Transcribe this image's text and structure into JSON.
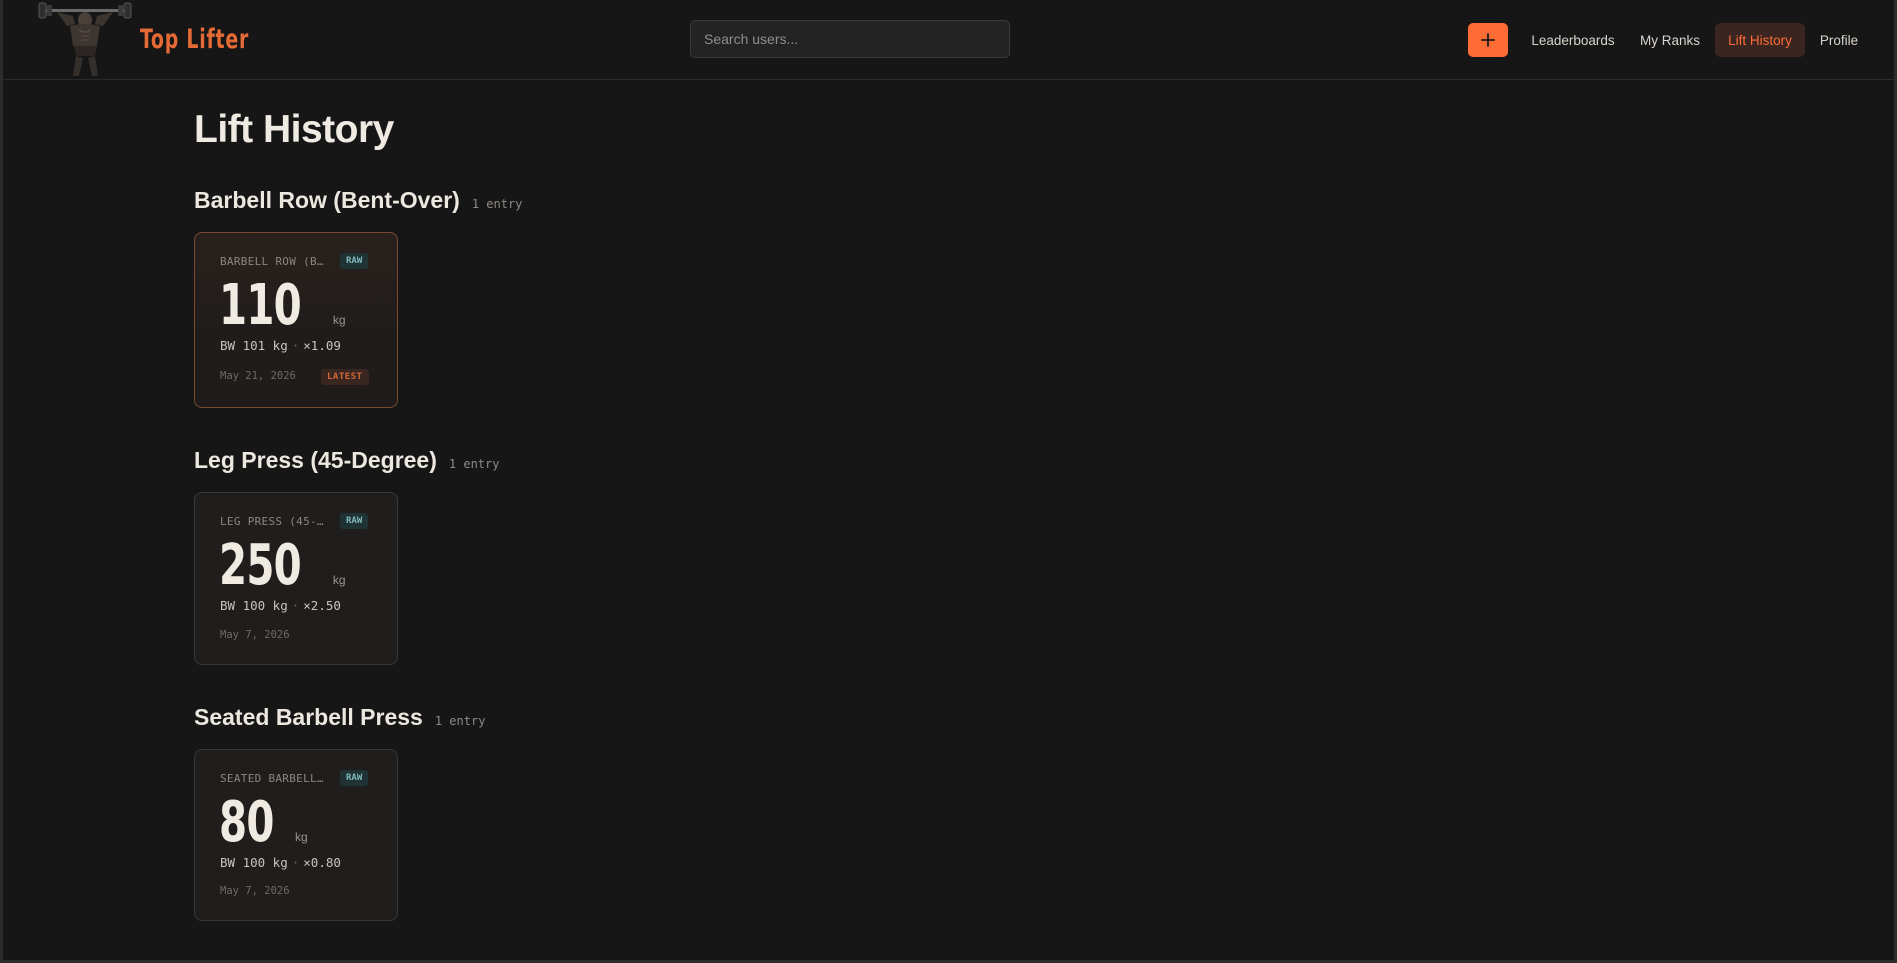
{
  "header": {
    "brand": "Top Lifter",
    "logo_icon": "weightlifter-logo-icon",
    "search": {
      "placeholder": "Search users...",
      "value": ""
    },
    "add_icon": "plus-icon",
    "nav": [
      {
        "label": "Leaderboards",
        "active": false
      },
      {
        "label": "My Ranks",
        "active": false
      },
      {
        "label": "Lift History",
        "active": true
      },
      {
        "label": "Profile",
        "active": false
      }
    ]
  },
  "page": {
    "title": "Lift History"
  },
  "sections": [
    {
      "title": "Barbell Row (Bent-Over)",
      "count": "1 entry",
      "entries": [
        {
          "label": "BARBELL ROW (B…",
          "badge": "RAW",
          "weight": "110",
          "unit": "kg",
          "bw": "BW 101 kg",
          "ratio": "×1.09",
          "date": "May 21, 2026",
          "latest": "LATEST"
        }
      ]
    },
    {
      "title": "Leg Press (45-Degree)",
      "count": "1 entry",
      "entries": [
        {
          "label": "LEG PRESS (45-…",
          "badge": "RAW",
          "weight": "250",
          "unit": "kg",
          "bw": "BW 100 kg",
          "ratio": "×2.50",
          "date": "May 7, 2026"
        }
      ]
    },
    {
      "title": "Seated Barbell Press",
      "count": "1 entry",
      "entries": [
        {
          "label": "SEATED BARBELL…",
          "badge": "RAW",
          "weight": "80",
          "unit": "kg",
          "bw": "BW 100 kg",
          "ratio": "×0.80",
          "date": "May 7, 2026"
        }
      ]
    }
  ],
  "colors": {
    "accent": "#ff6b35",
    "background": "#161616",
    "raw_badge": "#7fb7bb"
  }
}
